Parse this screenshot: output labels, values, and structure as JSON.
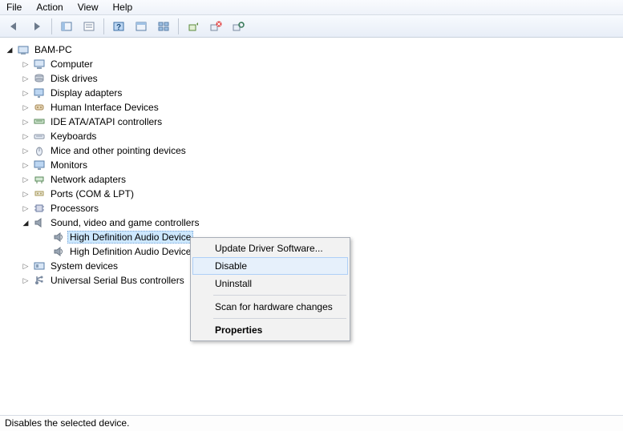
{
  "menubar": {
    "items": [
      "File",
      "Action",
      "View",
      "Help"
    ]
  },
  "root": {
    "label": "BAM-PC",
    "children": [
      {
        "label": "Computer"
      },
      {
        "label": "Disk drives"
      },
      {
        "label": "Display adapters"
      },
      {
        "label": "Human Interface Devices"
      },
      {
        "label": "IDE ATA/ATAPI controllers"
      },
      {
        "label": "Keyboards"
      },
      {
        "label": "Mice and other pointing devices"
      },
      {
        "label": "Monitors"
      },
      {
        "label": "Network adapters"
      },
      {
        "label": "Ports (COM & LPT)"
      },
      {
        "label": "Processors"
      },
      {
        "label": "Sound, video and game controllers",
        "expanded": true,
        "children": [
          {
            "label": "High Definition Audio Device",
            "selected": true
          },
          {
            "label": "High Definition Audio Device"
          }
        ]
      },
      {
        "label": "System devices"
      },
      {
        "label": "Universal Serial Bus controllers"
      }
    ]
  },
  "context_menu": {
    "items": [
      {
        "label": "Update Driver Software..."
      },
      {
        "label": "Disable",
        "hover": true
      },
      {
        "label": "Uninstall"
      },
      {
        "sep": true
      },
      {
        "label": "Scan for hardware changes"
      },
      {
        "sep": true
      },
      {
        "label": "Properties",
        "bold": true
      }
    ]
  },
  "statusbar": {
    "text": "Disables the selected device."
  }
}
